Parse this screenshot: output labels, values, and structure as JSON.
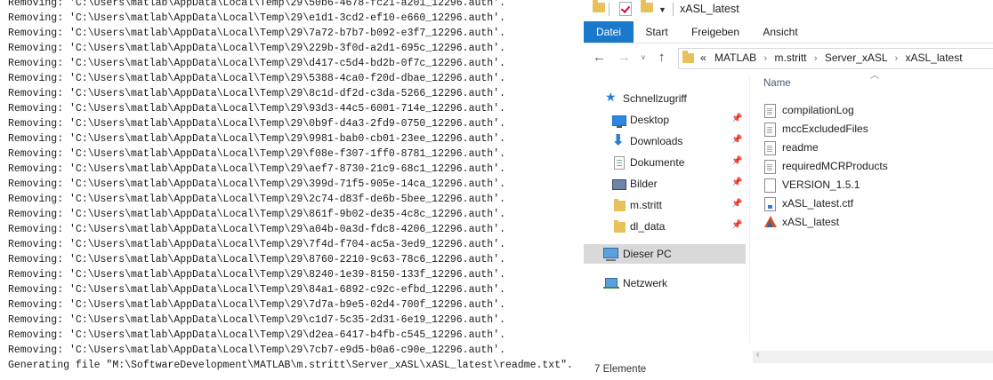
{
  "console": {
    "lines": [
      "Removing: 'C:\\Users\\matlab\\AppData\\Local\\Temp\\29\\50b6-4678-fc21-a201_12296.auth'.",
      "Removing: 'C:\\Users\\matlab\\AppData\\Local\\Temp\\29\\e1d1-3cd2-ef10-e660_12296.auth'.",
      "Removing: 'C:\\Users\\matlab\\AppData\\Local\\Temp\\29\\7a72-b7b7-b092-e3f7_12296.auth'.",
      "Removing: 'C:\\Users\\matlab\\AppData\\Local\\Temp\\29\\229b-3f0d-a2d1-695c_12296.auth'.",
      "Removing: 'C:\\Users\\matlab\\AppData\\Local\\Temp\\29\\d417-c5d4-bd2b-0f7c_12296.auth'.",
      "Removing: 'C:\\Users\\matlab\\AppData\\Local\\Temp\\29\\5388-4ca0-f20d-dbae_12296.auth'.",
      "Removing: 'C:\\Users\\matlab\\AppData\\Local\\Temp\\29\\8c1d-df2d-c3da-5266_12296.auth'.",
      "Removing: 'C:\\Users\\matlab\\AppData\\Local\\Temp\\29\\93d3-44c5-6001-714e_12296.auth'.",
      "Removing: 'C:\\Users\\matlab\\AppData\\Local\\Temp\\29\\0b9f-d4a3-2fd9-0750_12296.auth'.",
      "Removing: 'C:\\Users\\matlab\\AppData\\Local\\Temp\\29\\9981-bab0-cb01-23ee_12296.auth'.",
      "Removing: 'C:\\Users\\matlab\\AppData\\Local\\Temp\\29\\f08e-f307-1ff0-8781_12296.auth'.",
      "Removing: 'C:\\Users\\matlab\\AppData\\Local\\Temp\\29\\aef7-8730-21c9-68c1_12296.auth'.",
      "Removing: 'C:\\Users\\matlab\\AppData\\Local\\Temp\\29\\399d-71f5-905e-14ca_12296.auth'.",
      "Removing: 'C:\\Users\\matlab\\AppData\\Local\\Temp\\29\\2c74-d83f-de6b-5bee_12296.auth'.",
      "Removing: 'C:\\Users\\matlab\\AppData\\Local\\Temp\\29\\861f-9b02-de35-4c8c_12296.auth'.",
      "Removing: 'C:\\Users\\matlab\\AppData\\Local\\Temp\\29\\a04b-0a3d-fdc8-4206_12296.auth'.",
      "Removing: 'C:\\Users\\matlab\\AppData\\Local\\Temp\\29\\7f4d-f704-ac5a-3ed9_12296.auth'.",
      "Removing: 'C:\\Users\\matlab\\AppData\\Local\\Temp\\29\\8760-2210-9c63-78c6_12296.auth'.",
      "Removing: 'C:\\Users\\matlab\\AppData\\Local\\Temp\\29\\8240-1e39-8150-133f_12296.auth'.",
      "Removing: 'C:\\Users\\matlab\\AppData\\Local\\Temp\\29\\84a1-6892-c92c-efbd_12296.auth'.",
      "Removing: 'C:\\Users\\matlab\\AppData\\Local\\Temp\\29\\7d7a-b9e5-02d4-700f_12296.auth'.",
      "Removing: 'C:\\Users\\matlab\\AppData\\Local\\Temp\\29\\c1d7-5c35-2d31-6e19_12296.auth'.",
      "Removing: 'C:\\Users\\matlab\\AppData\\Local\\Temp\\29\\d2ea-6417-b4fb-c545_12296.auth'.",
      "Removing: 'C:\\Users\\matlab\\AppData\\Local\\Temp\\29\\7cb7-e9d5-b0a6-c90e_12296.auth'.",
      "Generating file \"M:\\SoftwareDevelopment\\MATLAB\\m.stritt\\Server_xASL\\xASL_latest\\readme.txt\"."
    ]
  },
  "explorer": {
    "window_title": "xASL_latest",
    "ribbon_tabs": [
      "Datei",
      "Start",
      "Freigeben",
      "Ansicht"
    ],
    "accent_color": "#1979ca",
    "breadcrumb": {
      "overflow": "«",
      "parts": [
        "MATLAB",
        "m.stritt",
        "Server_xASL",
        "xASL_latest"
      ]
    },
    "nav_items": [
      {
        "label": "Schnellzugriff",
        "icon": "star-icon"
      },
      {
        "label": "Desktop",
        "icon": "desktop-icon",
        "pinned": true
      },
      {
        "label": "Downloads",
        "icon": "download-icon",
        "pinned": true
      },
      {
        "label": "Dokumente",
        "icon": "documents-icon",
        "pinned": true
      },
      {
        "label": "Bilder",
        "icon": "pictures-icon",
        "pinned": true
      },
      {
        "label": "m.stritt",
        "icon": "folder-icon",
        "pinned": true
      },
      {
        "label": "dl_data",
        "icon": "folder-icon",
        "pinned": true
      },
      {
        "label": "Dieser PC",
        "icon": "computer-icon",
        "selected": true
      },
      {
        "label": "Netzwerk",
        "icon": "network-icon"
      }
    ],
    "column_header": "Name",
    "files": [
      {
        "name": "compilationLog",
        "icon": "text-file-icon"
      },
      {
        "name": "mccExcludedFiles",
        "icon": "text-file-icon"
      },
      {
        "name": "readme",
        "icon": "text-file-icon"
      },
      {
        "name": "requiredMCRProducts",
        "icon": "text-file-icon"
      },
      {
        "name": "VERSION_1.5.1",
        "icon": "blank-file-icon"
      },
      {
        "name": "xASL_latest.ctf",
        "icon": "ctf-file-icon"
      },
      {
        "name": "xASL_latest",
        "icon": "matlab-icon"
      }
    ],
    "status": "7 Elemente"
  }
}
